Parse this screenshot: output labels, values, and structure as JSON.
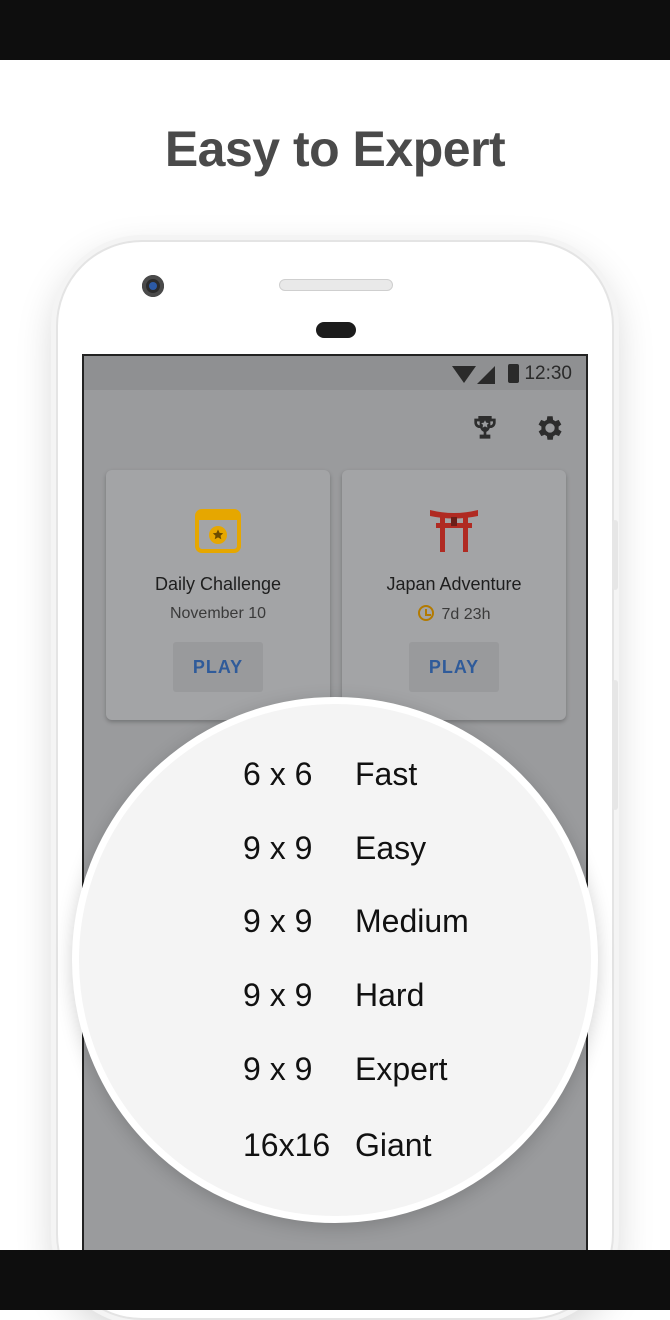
{
  "headline": "Easy to Expert",
  "status_bar": {
    "time": "12:30"
  },
  "cards": [
    {
      "title": "Daily Challenge",
      "subtitle": "November 10",
      "button": "PLAY",
      "icon": "calendar-star-icon"
    },
    {
      "title": "Japan Adventure",
      "subtitle": "7d 23h",
      "button": "PLAY",
      "icon": "torii-gate-icon"
    }
  ],
  "modes": [
    {
      "size": "6 x 6",
      "name": "Fast"
    },
    {
      "size": "9 x 9",
      "name": "Easy"
    },
    {
      "size": "9 x 9",
      "name": "Medium"
    },
    {
      "size": "9 x 9",
      "name": "Hard"
    },
    {
      "size": "9 x 9",
      "name": "Expert"
    },
    {
      "size": "16x16",
      "name": "Giant"
    }
  ],
  "colors": {
    "accent_blue": "#2f5b9a",
    "gold": "#e6a700",
    "torii_red": "#b02a22"
  }
}
